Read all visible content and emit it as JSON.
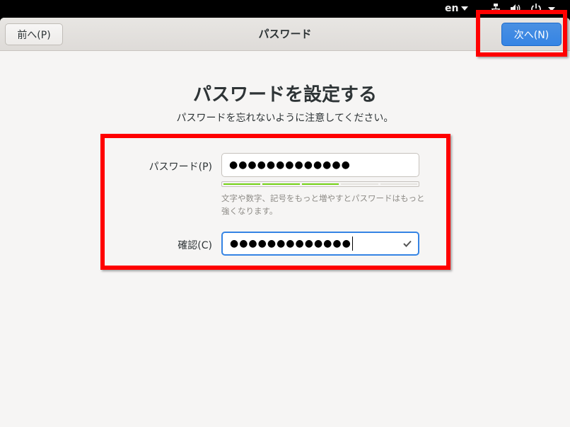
{
  "topbar": {
    "language": "en",
    "icons": [
      "network-icon",
      "volume-icon",
      "power-icon"
    ]
  },
  "headerbar": {
    "back_label": "前へ(P)",
    "title": "パスワード",
    "next_label": "次へ(N)"
  },
  "page": {
    "title": "パスワードを設定する",
    "subtitle": "パスワードを忘れないように注意してください。"
  },
  "form": {
    "password_label": "パスワード(P)",
    "password_value": "●●●●●●●●●●●●●",
    "strength_hint": "文字や数字、記号をもっと増やすとパスワードはもっと強くなります。",
    "confirm_label": "確認(C)",
    "confirm_value": "●●●●●●●●●●●●●"
  },
  "strength": {
    "segments_total": 5,
    "segments_filled": 3,
    "color": "#73d216"
  },
  "colors": {
    "accent": "#3584e4",
    "highlight": "#ff0000"
  }
}
